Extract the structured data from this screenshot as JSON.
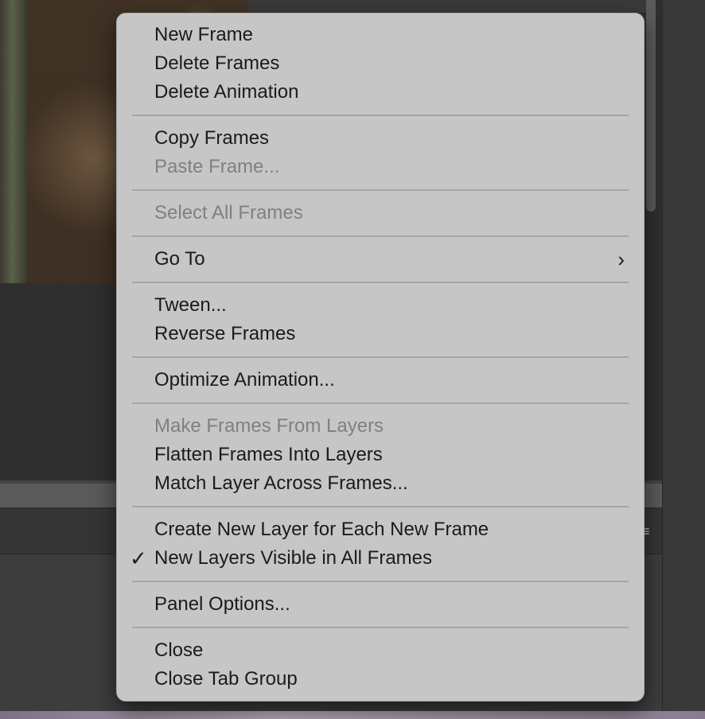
{
  "menu": {
    "groups": [
      {
        "items": [
          {
            "label": "New Frame",
            "enabled": true
          },
          {
            "label": "Delete Frames",
            "enabled": true
          },
          {
            "label": "Delete Animation",
            "enabled": true
          }
        ]
      },
      {
        "items": [
          {
            "label": "Copy Frames",
            "enabled": true
          },
          {
            "label": "Paste Frame...",
            "enabled": false
          }
        ]
      },
      {
        "items": [
          {
            "label": "Select All Frames",
            "enabled": false
          }
        ]
      },
      {
        "items": [
          {
            "label": "Go To",
            "enabled": true,
            "submenu": true
          }
        ]
      },
      {
        "items": [
          {
            "label": "Tween...",
            "enabled": true
          },
          {
            "label": "Reverse Frames",
            "enabled": true
          }
        ]
      },
      {
        "items": [
          {
            "label": "Optimize Animation...",
            "enabled": true
          }
        ]
      },
      {
        "items": [
          {
            "label": "Make Frames From Layers",
            "enabled": false
          },
          {
            "label": "Flatten Frames Into Layers",
            "enabled": true
          },
          {
            "label": "Match Layer Across Frames...",
            "enabled": true
          }
        ]
      },
      {
        "items": [
          {
            "label": "Create New Layer for Each New Frame",
            "enabled": true,
            "checked": false
          },
          {
            "label": "New Layers Visible in All Frames",
            "enabled": true,
            "checked": true
          }
        ]
      },
      {
        "items": [
          {
            "label": "Panel Options...",
            "enabled": true
          }
        ]
      },
      {
        "items": [
          {
            "label": "Close",
            "enabled": true
          },
          {
            "label": "Close Tab Group",
            "enabled": true
          }
        ]
      }
    ],
    "chevron_glyph": "›",
    "check_glyph": "✓",
    "colors": {
      "menu_background": "#c6c6c6",
      "text_enabled": "#1b1b1b",
      "text_disabled": "#808080",
      "separator": "#a5a5a5"
    }
  },
  "panel": {
    "menu_icon_glyph": "≡",
    "menu_icon": "panel-menu-icon"
  }
}
